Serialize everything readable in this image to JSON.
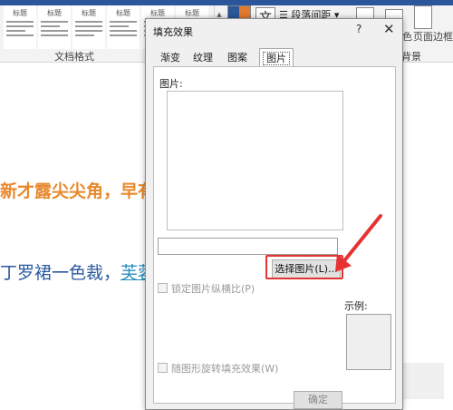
{
  "ribbon": {
    "styles": [
      {
        "label": "标题"
      },
      {
        "label": "标题"
      },
      {
        "label": "标题"
      },
      {
        "label": "标题"
      },
      {
        "label": "标题"
      },
      {
        "label": "标题"
      }
    ],
    "style_group_label": "文档格式",
    "paragraph_spacing_label": "段落间距",
    "font_btn_glyph": "文",
    "page_color_label": "色",
    "page_border_label": "页面边框",
    "page_bg_label": "背景",
    "scroll_up": "▲",
    "scroll_down": "▼",
    "scroll_more": "▾"
  },
  "document": {
    "line1": "新才露尖尖角，早有",
    "line2_a": "丁罗裙一色裁，",
    "line2_b": "芙蓉"
  },
  "dialog": {
    "title": "填充效果",
    "help": "?",
    "close": "✕",
    "tabs": [
      {
        "label": "渐变"
      },
      {
        "label": "纹理"
      },
      {
        "label": "图案"
      },
      {
        "label": "图片"
      }
    ],
    "active_tab": "图片",
    "picture_label": "图片:",
    "path_value": "",
    "select_picture_label": "选择图片(L)...",
    "lock_aspect_label": "锁定图片纵横比(P)",
    "rotate_with_shape_label": "随图形旋转填充效果(W)",
    "sample_label": "示例:",
    "ok_label": "确定"
  },
  "colors": {
    "accent": "#2b579a",
    "highlight": "#e53333",
    "doc_orange": "#e8892e",
    "doc_blue": "#2a5aa0"
  }
}
